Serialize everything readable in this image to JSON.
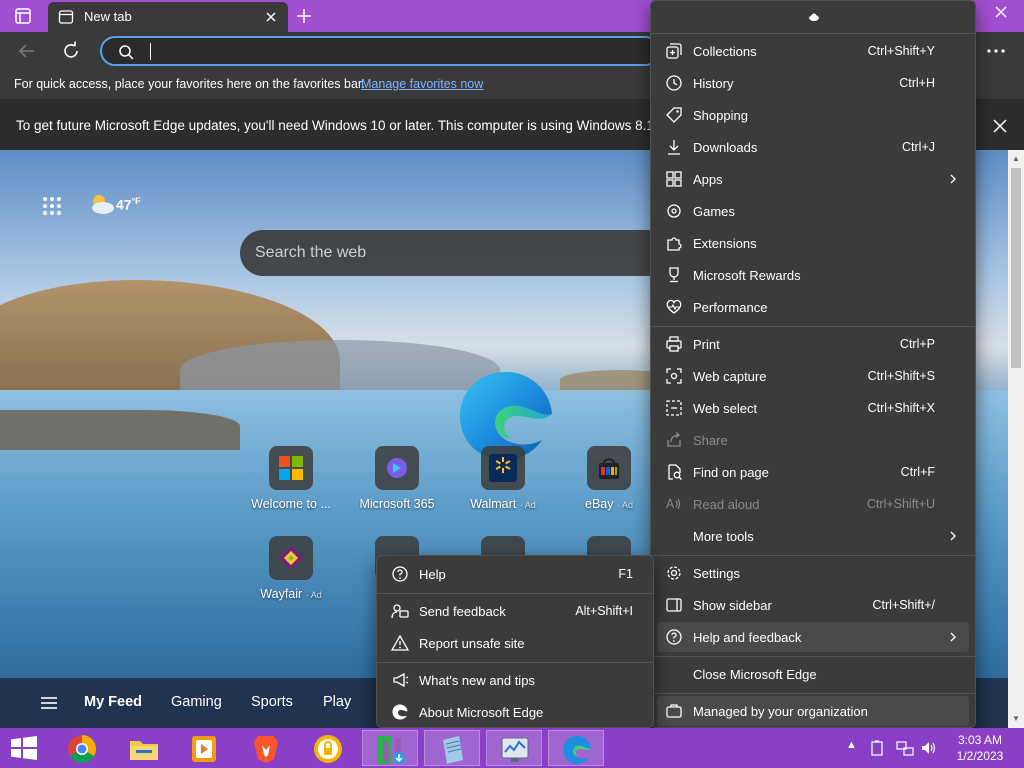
{
  "titlebar": {
    "tab_title": "New tab"
  },
  "favbar": {
    "text": "For quick access, place your favorites here on the favorites bar.",
    "link": "Manage favorites now"
  },
  "infobar": {
    "text": "To get future Microsoft Edge updates, you'll need Windows 10 or later. This computer is using Windows 8.1."
  },
  "newtab": {
    "weather": {
      "temp": "47",
      "unit": "°F"
    },
    "search_placeholder": "Search the web",
    "tiles": [
      {
        "label": "Welcome to ...",
        "ad": ""
      },
      {
        "label": "Microsoft 365",
        "ad": ""
      },
      {
        "label": "Walmart",
        "ad": "· Ad"
      },
      {
        "label": "eBay",
        "ad": "· Ad"
      },
      {
        "label": "Wayfair",
        "ad": "· Ad"
      }
    ],
    "feed": [
      "My Feed",
      "Gaming",
      "Sports",
      "Play"
    ]
  },
  "menu": {
    "items": [
      {
        "label": "Collections",
        "shortcut": "Ctrl+Shift+Y"
      },
      {
        "label": "History",
        "shortcut": "Ctrl+H"
      },
      {
        "label": "Shopping",
        "shortcut": ""
      },
      {
        "label": "Downloads",
        "shortcut": "Ctrl+J"
      },
      {
        "label": "Apps",
        "shortcut": ""
      },
      {
        "label": "Games",
        "shortcut": ""
      },
      {
        "label": "Extensions",
        "shortcut": ""
      },
      {
        "label": "Microsoft Rewards",
        "shortcut": ""
      },
      {
        "label": "Performance",
        "shortcut": ""
      },
      {
        "label": "Print",
        "shortcut": "Ctrl+P"
      },
      {
        "label": "Web capture",
        "shortcut": "Ctrl+Shift+S"
      },
      {
        "label": "Web select",
        "shortcut": "Ctrl+Shift+X"
      },
      {
        "label": "Share",
        "shortcut": ""
      },
      {
        "label": "Find on page",
        "shortcut": "Ctrl+F"
      },
      {
        "label": "Read aloud",
        "shortcut": "Ctrl+Shift+U"
      },
      {
        "label": "More tools",
        "shortcut": ""
      },
      {
        "label": "Settings",
        "shortcut": ""
      },
      {
        "label": "Show sidebar",
        "shortcut": "Ctrl+Shift+/"
      },
      {
        "label": "Help and feedback",
        "shortcut": ""
      },
      {
        "label": "Close Microsoft Edge",
        "shortcut": ""
      },
      {
        "label": "Managed by your organization",
        "shortcut": ""
      }
    ]
  },
  "help_menu": {
    "items": [
      {
        "label": "Help",
        "shortcut": "F1"
      },
      {
        "label": "Send feedback",
        "shortcut": "Alt+Shift+I"
      },
      {
        "label": "Report unsafe site",
        "shortcut": ""
      },
      {
        "label": "What's new and tips",
        "shortcut": ""
      },
      {
        "label": "About Microsoft Edge",
        "shortcut": ""
      }
    ]
  },
  "taskbar": {
    "time": "3:03 AM",
    "date": "1/2/2023"
  },
  "colors": {
    "titlebar": "#a04fd0",
    "taskbar": "#8a3fc7",
    "menu_bg": "#3b3b3b",
    "link": "#7fb4ff",
    "focus_ring": "#5aa0f0"
  }
}
